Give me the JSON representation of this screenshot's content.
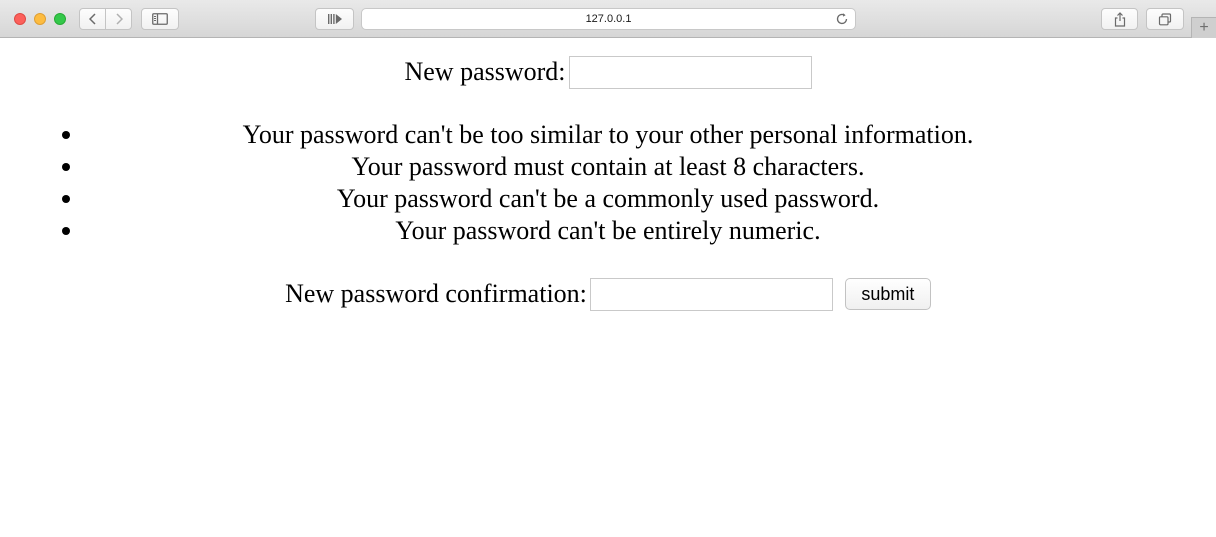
{
  "browser": {
    "url": "127.0.0.1",
    "new_tab_label": "+"
  },
  "form": {
    "new_password_label": "New password:",
    "new_password_value": "",
    "rules": [
      "Your password can't be too similar to your other personal information.",
      "Your password must contain at least 8 characters.",
      "Your password can't be a commonly used password.",
      "Your password can't be entirely numeric."
    ],
    "confirmation_label": "New password confirmation:",
    "confirmation_value": "",
    "submit_label": "submit"
  },
  "icons": {
    "back": "chevron-left-icon",
    "forward": "chevron-right-icon",
    "sidebar": "sidebar-icon",
    "reader": "reader-icon",
    "reload": "reload-icon",
    "share": "share-icon",
    "tabs": "tabs-overview-icon"
  },
  "colors": {
    "close": "#fc605b",
    "minimize": "#fdbc40",
    "zoom": "#34c84a"
  }
}
